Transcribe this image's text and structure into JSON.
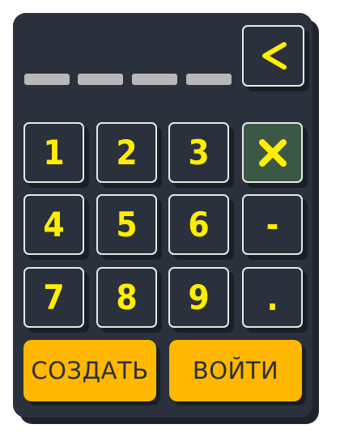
{
  "pin_display": {
    "slots": 4,
    "entered": 0
  },
  "keys": {
    "k1": "1",
    "k2": "2",
    "k3": "3",
    "k4": "4",
    "k5": "5",
    "k6": "6",
    "k7": "7",
    "k8": "8",
    "k9": "9",
    "minus": "-",
    "dot": "."
  },
  "icons": {
    "backspace": "chevron-left-icon",
    "clear": "x-icon"
  },
  "buttons": {
    "create": "СОЗДАТЬ",
    "login": "ВОЙТИ"
  },
  "colors": {
    "panel": "#2a313c",
    "key_text": "#ffee00",
    "action_button": "#ffb700",
    "clear_key": "#3b5745"
  }
}
